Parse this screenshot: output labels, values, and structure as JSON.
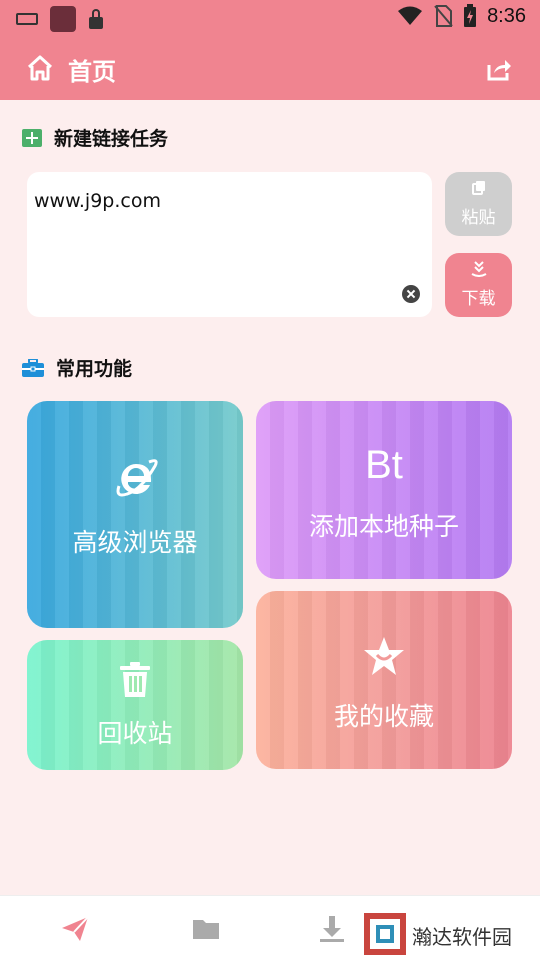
{
  "status_bar": {
    "time": "8:36"
  },
  "app_bar": {
    "title": "首页"
  },
  "new_link_section": {
    "heading": "新建链接任务",
    "url_value": "www.j9p.com",
    "paste_label": "粘贴",
    "download_label": "下载"
  },
  "features_section": {
    "heading": "常用功能",
    "tiles": [
      {
        "label": "高级浏览器",
        "icon": "ie-browser-icon"
      },
      {
        "label": "添加本地种子",
        "icon_text": "Bt"
      },
      {
        "label": "回收站",
        "icon": "trash-icon"
      },
      {
        "label": "我的收藏",
        "icon": "star-icon"
      }
    ]
  },
  "bottom_nav": {
    "items": [
      {
        "icon": "send-icon",
        "active": true
      },
      {
        "icon": "folder-icon",
        "active": false
      },
      {
        "icon": "download-icon",
        "active": false
      }
    ]
  },
  "watermark": {
    "text": "瀚达软件园"
  },
  "colors": {
    "primary": "#F08490",
    "background": "#FDEEEE",
    "browser_tile": "#3AA8DF",
    "bt_tile": "#C88AF5",
    "recycle_tile": "#8FEDB9",
    "favorite_tile": "#F29A99"
  }
}
